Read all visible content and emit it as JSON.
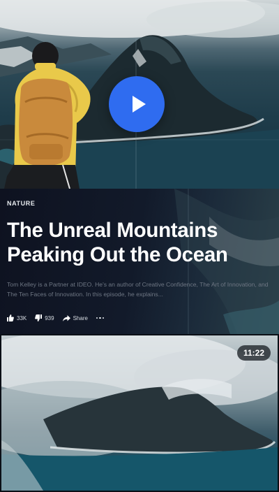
{
  "hero": {
    "play_label": "play-video"
  },
  "article": {
    "category": "NATURE",
    "title": "The Unreal Mountains Peaking Out the Ocean",
    "description": "Tom Kelley is a Partner at IDEO. He's an author of Creative Confidence, The Art of Innovation, and The Ten Faces of Innovation. In this episode, he explains...",
    "likes": "33K",
    "dislikes": "939",
    "share_label": "Share"
  },
  "video": {
    "duration": "11:22"
  },
  "colors": {
    "play_button": "#2f6cf0",
    "article_bg": "#0e1220",
    "description_text": "#6e7683"
  },
  "icons": [
    "play-icon",
    "thumbs-up-icon",
    "thumbs-down-icon",
    "share-icon",
    "more-icon"
  ]
}
